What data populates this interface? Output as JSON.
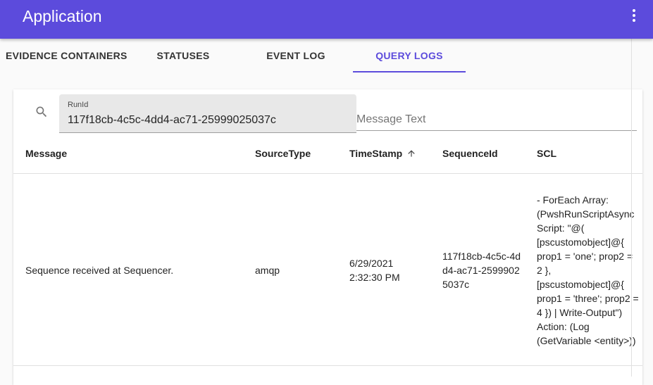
{
  "app": {
    "title": "Application"
  },
  "tabs": [
    {
      "label": "EVIDENCE CONTAINERS"
    },
    {
      "label": "STATUSES"
    },
    {
      "label": "EVENT LOG"
    },
    {
      "label": "QUERY LOGS",
      "active": true
    }
  ],
  "filters": {
    "runid_label": "RunId",
    "runid_value": "117f18cb-4c5c-4dd4-ac71-25999025037c",
    "message_placeholder": "Message Text"
  },
  "table": {
    "columns": [
      "Message",
      "SourceType",
      "TimeStamp",
      "SequenceId",
      "SCL"
    ],
    "sort": {
      "column": "TimeStamp",
      "direction": "ascending"
    },
    "rows": [
      {
        "message": "Sequence received at Sequencer.",
        "source_type": "amqp",
        "timestamp": "6/29/2021 2:32:30 PM",
        "sequence_id": "117f18cb-4c5c-4dd4-ac71-25999025037c",
        "scl": "- ForEach Array: (PwshRunScriptAsync Script: \"@( [pscustomobject]@{ prop1 = 'one'; prop2 = 2 }, [pscustomobject]@{ prop1 = 'three'; prop2 = 4 }) | Write-Output\") Action: (Log (GetVariable <entity>))"
      }
    ]
  },
  "colors": {
    "primary": "#5c4bdc"
  },
  "icons": {
    "menu": "more-vert-icon",
    "search": "search-icon",
    "sort": "arrow-upward-icon"
  }
}
